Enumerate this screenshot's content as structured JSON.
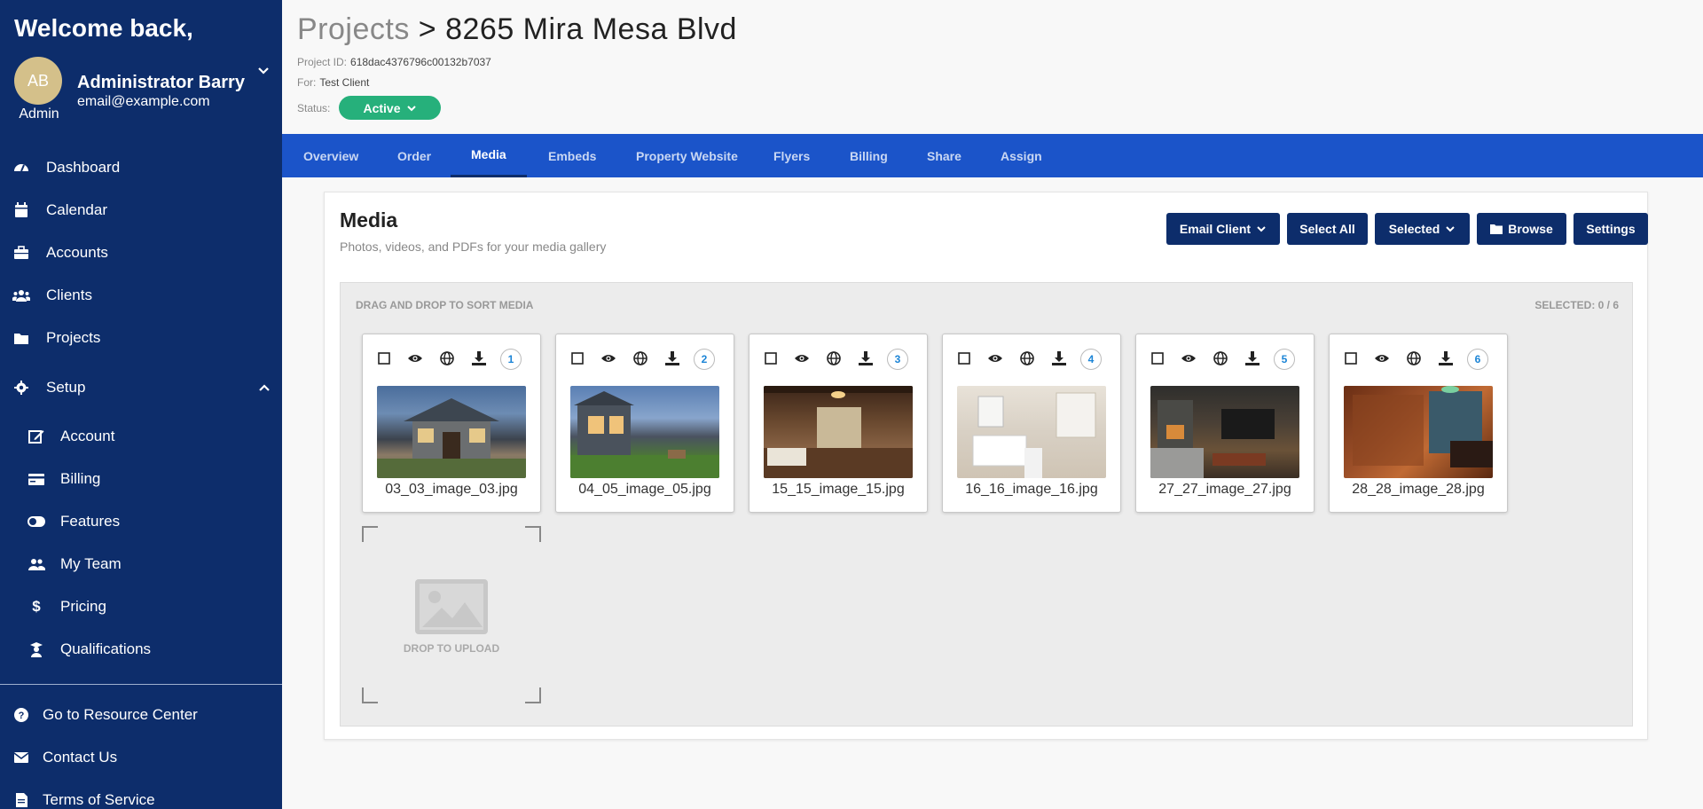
{
  "sidebar": {
    "welcome": "Welcome back,",
    "avatar_initials": "AB",
    "role": "Admin",
    "user_name": "Administrator Barry",
    "user_email": "email@example.com",
    "nav": [
      {
        "label": "Dashboard",
        "icon": "dashboard-icon"
      },
      {
        "label": "Calendar",
        "icon": "calendar-icon"
      },
      {
        "label": "Accounts",
        "icon": "briefcase-icon"
      },
      {
        "label": "Clients",
        "icon": "users-icon"
      },
      {
        "label": "Projects",
        "icon": "folder-icon"
      }
    ],
    "setup_label": "Setup",
    "setup_items": [
      {
        "label": "Account",
        "icon": "edit-icon"
      },
      {
        "label": "Billing",
        "icon": "credit-card-icon"
      },
      {
        "label": "Features",
        "icon": "toggle-icon"
      },
      {
        "label": "My Team",
        "icon": "team-icon"
      },
      {
        "label": "Pricing",
        "icon": "dollar-icon"
      },
      {
        "label": "Qualifications",
        "icon": "graduate-icon"
      }
    ],
    "footer": [
      {
        "label": "Go to Resource Center",
        "icon": "help-icon"
      },
      {
        "label": "Contact Us",
        "icon": "envelope-icon"
      },
      {
        "label": "Terms of Service",
        "icon": "document-icon"
      }
    ]
  },
  "header": {
    "crumb": "Projects",
    "separator": ">",
    "title": "8265 Mira Mesa Blvd",
    "project_id_label": "Project ID:",
    "project_id": "618dac4376796c00132b7037",
    "for_label": "For:",
    "for_value": "Test Client",
    "status_label": "Status:",
    "status_value": "Active"
  },
  "tabs": [
    "Overview",
    "Order",
    "Media",
    "Embeds",
    "Property Website",
    "Flyers",
    "Billing",
    "Share",
    "Assign"
  ],
  "active_tab": "Media",
  "media": {
    "title": "Media",
    "subtitle": "Photos, videos, and PDFs for your media gallery",
    "buttons": {
      "email_client": "Email Client",
      "select_all": "Select All",
      "selected": "Selected",
      "browse": "Browse",
      "settings": "Settings"
    },
    "drag_label": "DRAG AND DROP TO SORT MEDIA",
    "selected_count": "SELECTED: 0 / 6",
    "items": [
      {
        "name": "03_03_image_03.jpg",
        "number": "1"
      },
      {
        "name": "04_05_image_05.jpg",
        "number": "2"
      },
      {
        "name": "15_15_image_15.jpg",
        "number": "3"
      },
      {
        "name": "16_16_image_16.jpg",
        "number": "4"
      },
      {
        "name": "27_27_image_27.jpg",
        "number": "5"
      },
      {
        "name": "28_28_image_28.jpg",
        "number": "6"
      }
    ],
    "drop_label": "DROP TO UPLOAD"
  },
  "colors": {
    "sidebar": "#0d2d6b",
    "tabbar": "#1b54c9",
    "status": "#26b07b",
    "button": "#0d2d6b"
  }
}
